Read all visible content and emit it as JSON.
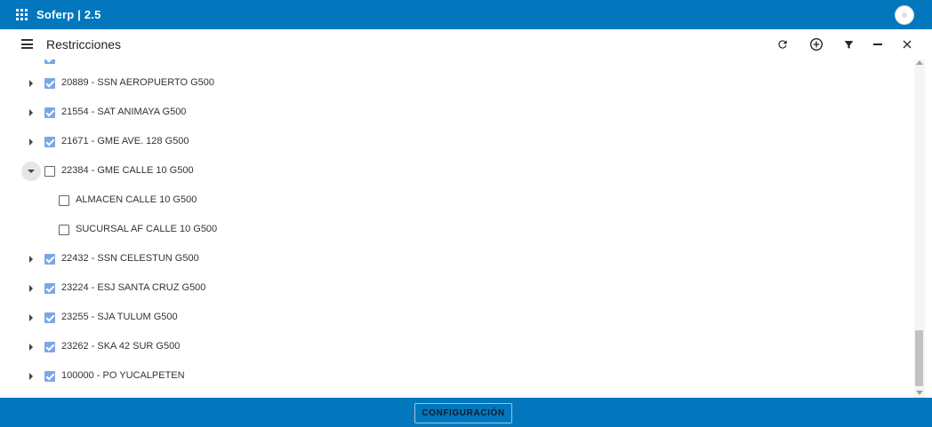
{
  "app": {
    "title": "Soferp | 2.5"
  },
  "toolbar": {
    "title": "Restricciones",
    "actions": [
      {
        "name": "refresh-icon"
      },
      {
        "name": "add-circle-icon"
      },
      {
        "name": "filter-icon"
      },
      {
        "name": "minimize-icon"
      },
      {
        "name": "close-icon"
      }
    ]
  },
  "tree": {
    "rows": [
      {
        "label": "20889 - SSN AEROPUERTO G500",
        "checked": true,
        "level": 0,
        "expanded": false
      },
      {
        "label": "21554 - SAT ANIMAYA G500",
        "checked": true,
        "level": 0,
        "expanded": false
      },
      {
        "label": "21671 - GME AVE. 128 G500",
        "checked": true,
        "level": 0,
        "expanded": false
      },
      {
        "label": "22384 - GME CALLE 10 G500",
        "checked": false,
        "level": 0,
        "expanded": true
      },
      {
        "label": "ALMACEN CALLE 10 G500",
        "checked": false,
        "level": 1
      },
      {
        "label": "SUCURSAL AF CALLE 10 G500",
        "checked": false,
        "level": 1
      },
      {
        "label": "22432 - SSN CELESTUN G500",
        "checked": true,
        "level": 0,
        "expanded": false
      },
      {
        "label": "23224 - ESJ SANTA CRUZ G500",
        "checked": true,
        "level": 0,
        "expanded": false
      },
      {
        "label": "23255 - SJA TULUM G500",
        "checked": true,
        "level": 0,
        "expanded": false
      },
      {
        "label": "23262 - SKA 42 SUR G500",
        "checked": true,
        "level": 0,
        "expanded": false
      },
      {
        "label": "100000 - PO YUCALPETEN",
        "checked": true,
        "level": 0,
        "expanded": false
      }
    ]
  },
  "footer": {
    "config_label": "CONFIGURACIÓN"
  },
  "colors": {
    "primary": "#0277bd",
    "checkbox": "#7ba7e8"
  }
}
